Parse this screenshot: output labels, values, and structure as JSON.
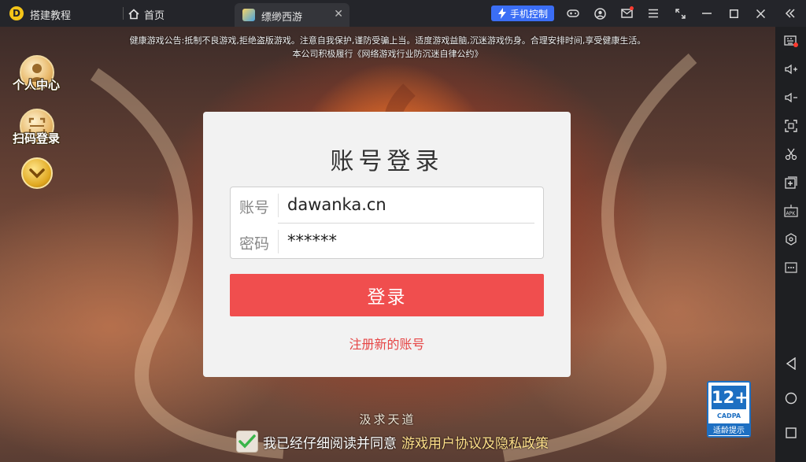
{
  "titlebar": {
    "app_name": "搭建教程",
    "home_tab": "首页",
    "game_tab": "缥缈西游",
    "phone_control": "手机控制"
  },
  "game": {
    "notice_line1": "健康游戏公告:抵制不良游戏,拒绝盗版游戏。注意自我保护,谨防受骗上当。适度游戏益脑,沉迷游戏伤身。合理安排时间,享受健康生活。",
    "notice_line2": "本公司积极履行《网络游戏行业防沉迷自律公约》",
    "left_menu": {
      "personal_center": "个人中心",
      "scan_login": "扫码登录"
    },
    "login": {
      "title": "账号登录",
      "account_label": "账号",
      "account_value": "dawanka.cn",
      "password_label": "密码",
      "password_value": "******",
      "login_button": "登录",
      "register_link": "注册新的账号"
    },
    "slogan": "汲求天道",
    "agreement_prefix": "我已经仔细阅读并同意",
    "agreement_link": "游戏用户协议及隐私政策",
    "age_rating": {
      "age": "12+",
      "org": "CADPA",
      "tip": "适龄提示"
    }
  },
  "colors": {
    "accent_blue": "#3b6ef5",
    "login_button": "#f04e4e",
    "register_link": "#e64545",
    "policy_link": "#ffe08a"
  }
}
